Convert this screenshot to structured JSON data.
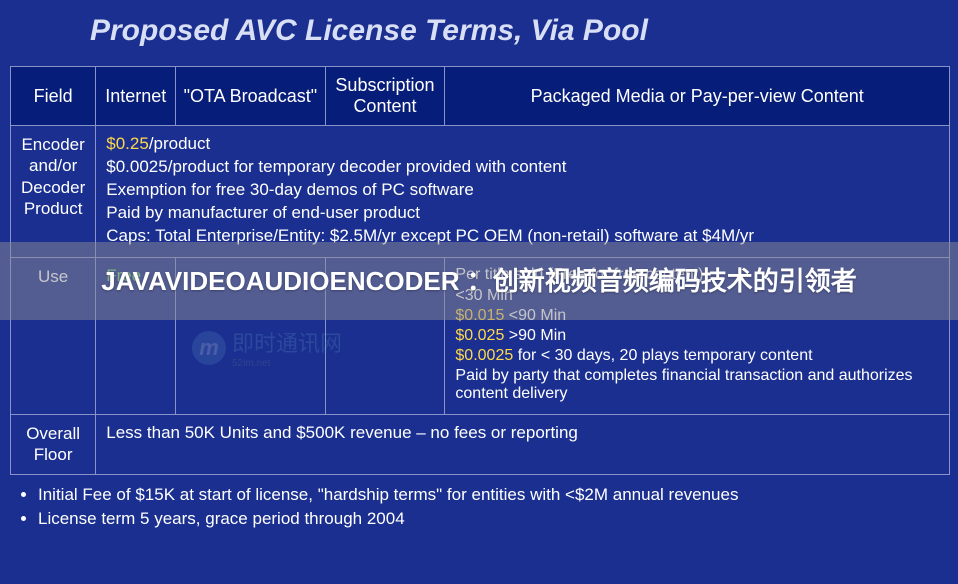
{
  "title": "Proposed AVC License Terms, Via Pool",
  "headers": {
    "field": "Field",
    "internet": "Internet",
    "ota": "\"OTA Broadcast\"",
    "subscription": "Subscription Content",
    "packaged": "Packaged Media or Pay-per-view Content"
  },
  "rows": {
    "encoder": {
      "label": "Encoder and/or Decoder Product",
      "price_main": "$0.25",
      "price_main_suffix": "/product",
      "lines": [
        "$0.0025/product for temporary decoder provided with content",
        "Exemption for free 30-day demos of PC software",
        "Paid by manufacturer of end-user product",
        "Caps: Total Enterprise/Entity: $2.5M/yr except PC OEM (non-retail) software at $4M/yr"
      ]
    },
    "use": {
      "label": "Use",
      "free": "Free",
      "pkg_header": "Per title sold (Free for free content)",
      "tiers": [
        {
          "price": "",
          "text": "<30 Min"
        },
        {
          "price": "$0.015",
          "text": "<90 Min"
        },
        {
          "price": "$0.025",
          "text": ">90 Min"
        },
        {
          "price": "$0.0025",
          "text": "for < 30 days, 20 plays  temporary content"
        }
      ],
      "pkg_footer": "Paid by party that completes financial transaction and authorizes content delivery"
    },
    "floor": {
      "label": "Overall Floor",
      "text": "Less than 50K Units and $500K revenue – no fees or reporting"
    }
  },
  "bullets": [
    "Initial Fee of $15K at start of license, \"hardship terms\" for entities with <$2M annual revenues",
    "License term 5 years, grace period through 2004"
  ],
  "overlay": "JAVAVIDEOAUDIOENCODER ：创新视频音频编码技术的引领者",
  "watermark": {
    "badge": "m",
    "text": "即时通讯网",
    "sub": "52im.net"
  }
}
